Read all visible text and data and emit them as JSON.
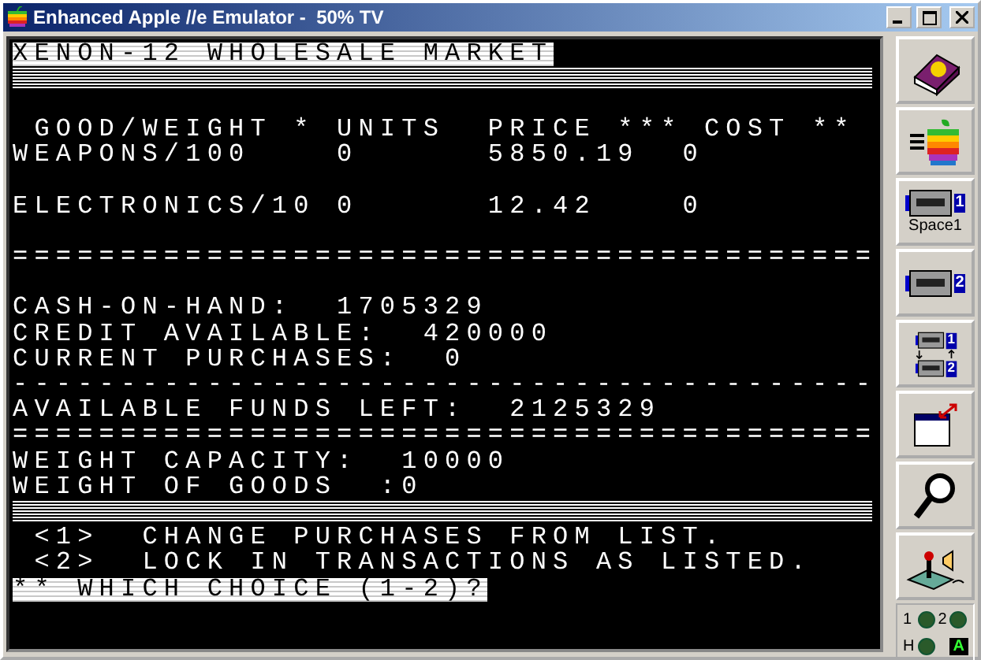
{
  "window": {
    "title": "Enhanced Apple //e Emulator -  50% TV"
  },
  "screen": {
    "lines": [
      {
        "kind": "inverse",
        "text": "XENON-12 WHOLESALE MARKET"
      },
      {
        "kind": "bar"
      },
      {
        "kind": "blank"
      },
      {
        "kind": "text",
        "text": " GOOD/WEIGHT * UNITS  PRICE *** COST **"
      },
      {
        "kind": "text",
        "text": "WEAPONS/100    0      5850.19  0"
      },
      {
        "kind": "blank"
      },
      {
        "kind": "text",
        "text": "ELECTRONICS/10 0      12.42    0"
      },
      {
        "kind": "blank"
      },
      {
        "kind": "text",
        "text": "========================================"
      },
      {
        "kind": "blank"
      },
      {
        "kind": "text",
        "text": "CASH-ON-HAND:  1705329"
      },
      {
        "kind": "text",
        "text": "CREDIT AVAILABLE:  420000"
      },
      {
        "kind": "text",
        "text": "CURRENT PURCHASES:  0"
      },
      {
        "kind": "text",
        "text": "----------------------------------------"
      },
      {
        "kind": "text",
        "text": "AVAILABLE FUNDS LEFT:  2125329"
      },
      {
        "kind": "text",
        "text": "========================================"
      },
      {
        "kind": "text",
        "text": "WEIGHT CAPACITY:  10000"
      },
      {
        "kind": "text",
        "text": "WEIGHT OF GOODS  :0"
      },
      {
        "kind": "bar"
      },
      {
        "kind": "text",
        "text": " <1>  CHANGE PURCHASES FROM LIST."
      },
      {
        "kind": "text",
        "text": " <2>  LOCK IN TRANSACTIONS AS LISTED."
      },
      {
        "kind": "inverse",
        "text": "** WHICH CHOICE (1-2)?"
      }
    ]
  },
  "toolbar": [
    {
      "kind": "help"
    },
    {
      "kind": "reset"
    },
    {
      "kind": "drive",
      "badge": "1",
      "label": "Space1"
    },
    {
      "kind": "drive",
      "badge": "2"
    },
    {
      "kind": "swap",
      "badges": [
        "1",
        "2"
      ]
    },
    {
      "kind": "fullscreen"
    },
    {
      "kind": "debug"
    },
    {
      "kind": "joystick"
    }
  ],
  "status": {
    "leds": [
      {
        "label": "1",
        "on": false
      },
      {
        "label": "2",
        "on": false
      },
      {
        "label": "H",
        "on": false
      }
    ],
    "caps": {
      "text": "A",
      "on": true
    }
  }
}
